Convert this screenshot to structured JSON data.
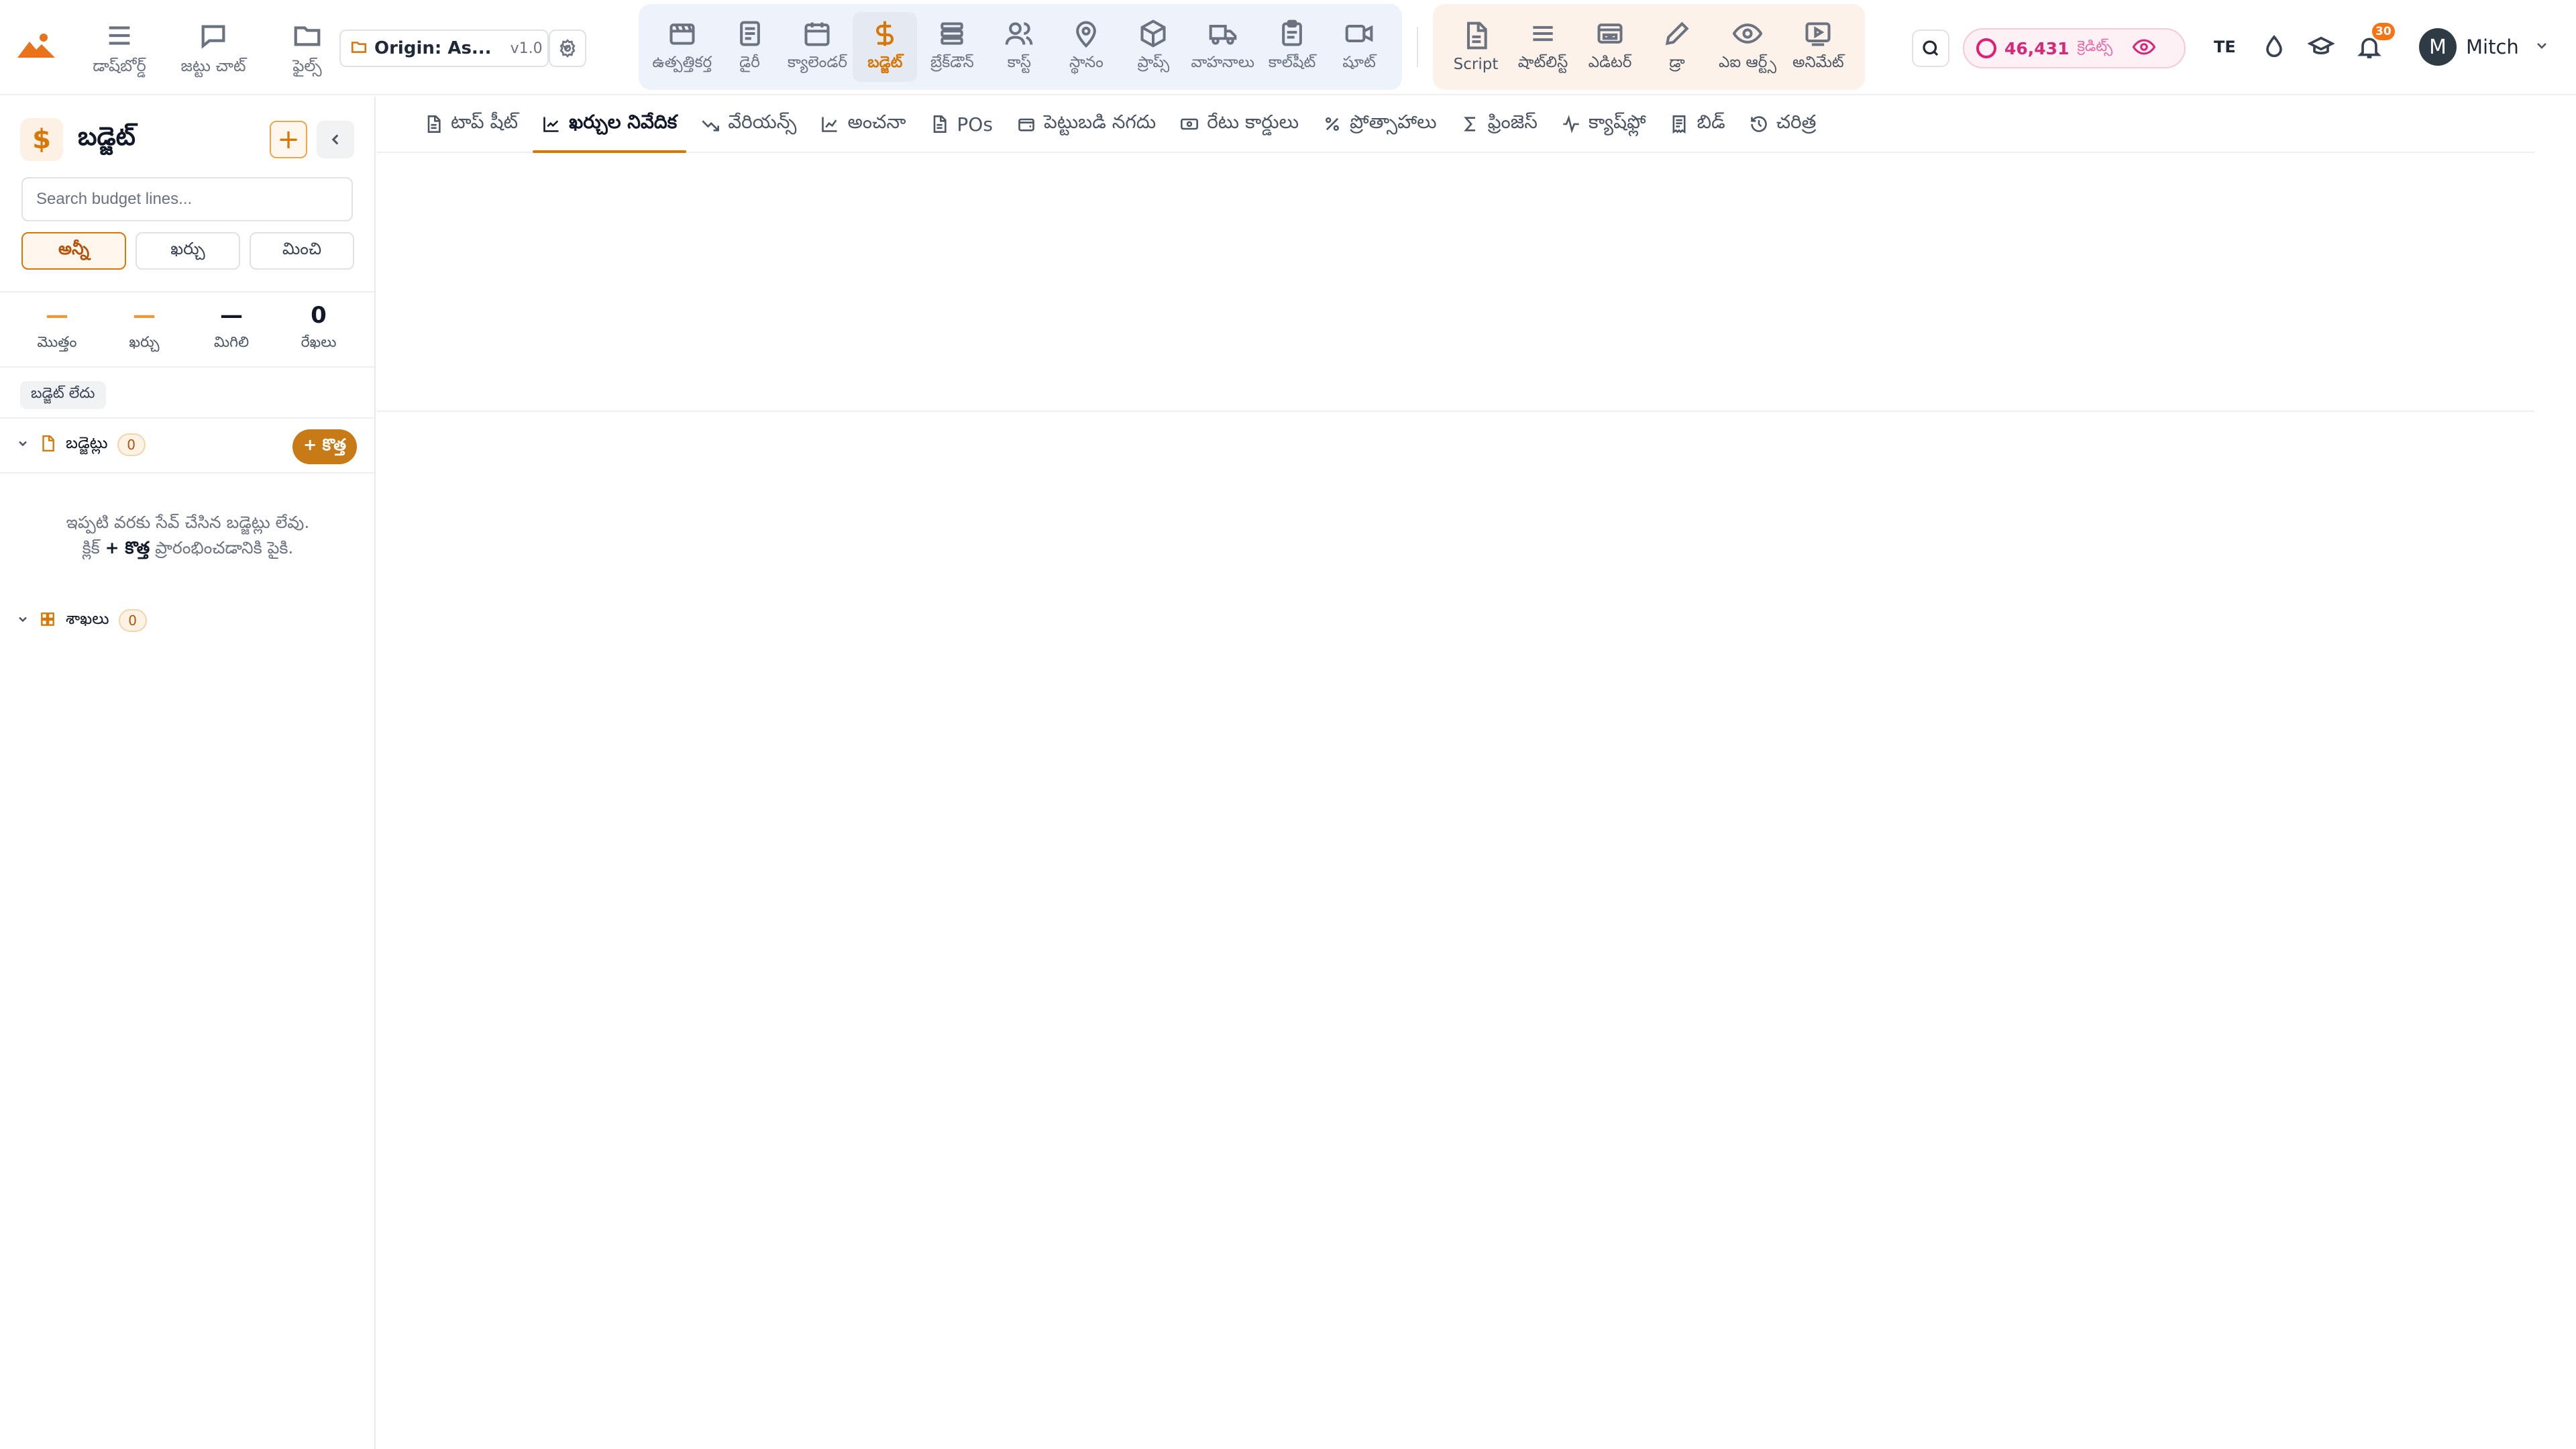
{
  "colors": {
    "accent": "#d97706",
    "credits": "#db2777",
    "nav_blue_bg": "#eef3fb",
    "nav_orange_bg": "#fdf2ea"
  },
  "left_nav": [
    {
      "label": "డాష్‌బోర్డ్",
      "icon": "menu-icon"
    },
    {
      "label": "జట్టు చాట్",
      "icon": "chat-icon"
    },
    {
      "label": "ఫైల్స్",
      "icon": "folder-icon"
    }
  ],
  "project": {
    "name": "Origin: As...",
    "version": "v1.0"
  },
  "production_nav": [
    {
      "label": "ఉత్పత్తికర్త",
      "icon": "clapperboard-icon"
    },
    {
      "label": "డైరీ",
      "icon": "document-icon"
    },
    {
      "label": "క్యాలెండర్",
      "icon": "calendar-icon"
    },
    {
      "label": "బడ్జెట్",
      "icon": "dollar-icon",
      "active": true
    },
    {
      "label": "బ్రేక్‌డౌన్",
      "icon": "stack-icon"
    },
    {
      "label": "కాస్ట్",
      "icon": "users-icon"
    },
    {
      "label": "స్థానం",
      "icon": "map-pin-icon"
    },
    {
      "label": "ప్రాప్స్",
      "icon": "box-icon"
    },
    {
      "label": "వాహనాలు",
      "icon": "truck-icon"
    },
    {
      "label": "కాల్‌షీట్",
      "icon": "clipboard-icon"
    },
    {
      "label": "షూట్",
      "icon": "video-icon"
    }
  ],
  "creative_nav": [
    {
      "label": "Script",
      "icon": "script-icon"
    },
    {
      "label": "షాట్‌లిస్ట్",
      "icon": "list-icon"
    },
    {
      "label": "ఎడిటర్",
      "icon": "editor-icon"
    },
    {
      "label": "డ్రా",
      "icon": "pencil-icon"
    },
    {
      "label": "ఎఐ ఆర్ట్స్",
      "icon": "eye-icon"
    },
    {
      "label": "అనిమేట్",
      "icon": "animate-icon"
    }
  ],
  "credits": {
    "value": "46,431",
    "label": "క్రెడిట్స్"
  },
  "language": "TE",
  "notifications": {
    "count": "30"
  },
  "user": {
    "initial": "M",
    "name": "Mitch"
  },
  "sidebar": {
    "title": "బడ్జెట్",
    "icon": "$",
    "add_label": "+",
    "search_placeholder": "Search budget lines...",
    "filters": [
      "అన్నీ",
      "ఖర్చు",
      "మించి"
    ],
    "stats": [
      {
        "value": "—",
        "label": "మొత్తం"
      },
      {
        "value": "—",
        "label": "ఖర్చు"
      },
      {
        "value": "—",
        "label": "మిగిలి"
      },
      {
        "value": "0",
        "label": "రేఖలు"
      }
    ],
    "tag": "బడ్జెట్ లేదు",
    "budgets_section": {
      "title": "బడ్జెట్లు",
      "count": "0",
      "new_label": "+ కొత్త"
    },
    "empty_line1": "ఇప్పటి వరకు సేవ్ చేసిన బడ్జెట్లు లేవు.",
    "empty_line2a": "క్లిక్",
    "empty_line2b": "+ కొత్త",
    "empty_line2c": "ప్రారంభించడానికి పైకి.",
    "branches_section": {
      "title": "శాఖలు",
      "count": "0"
    }
  },
  "tabs": [
    {
      "label": "టాప్ షీట్",
      "icon": "file-icon"
    },
    {
      "label": "ఖర్చుల నివేదిక",
      "icon": "chart-line-icon",
      "active": true
    },
    {
      "label": "వేరియన్స్",
      "icon": "trend-icon"
    },
    {
      "label": "అంచనా",
      "icon": "chart-icon"
    },
    {
      "label": "POs",
      "icon": "file-icon"
    },
    {
      "label": "పెట్టుబడి నగదు",
      "icon": "wallet-icon"
    },
    {
      "label": "రేటు కార్డులు",
      "icon": "card-icon"
    },
    {
      "label": "ప్రోత్సాహాలు",
      "icon": "percent-icon"
    },
    {
      "label": "ఫ్రింజెస్",
      "icon": "sigma-icon"
    },
    {
      "label": "క్యాష్‌ఫ్లో",
      "icon": "pulse-icon"
    },
    {
      "label": "బిడ్",
      "icon": "receipt-icon"
    },
    {
      "label": "చరిత్ర",
      "icon": "history-icon"
    }
  ]
}
